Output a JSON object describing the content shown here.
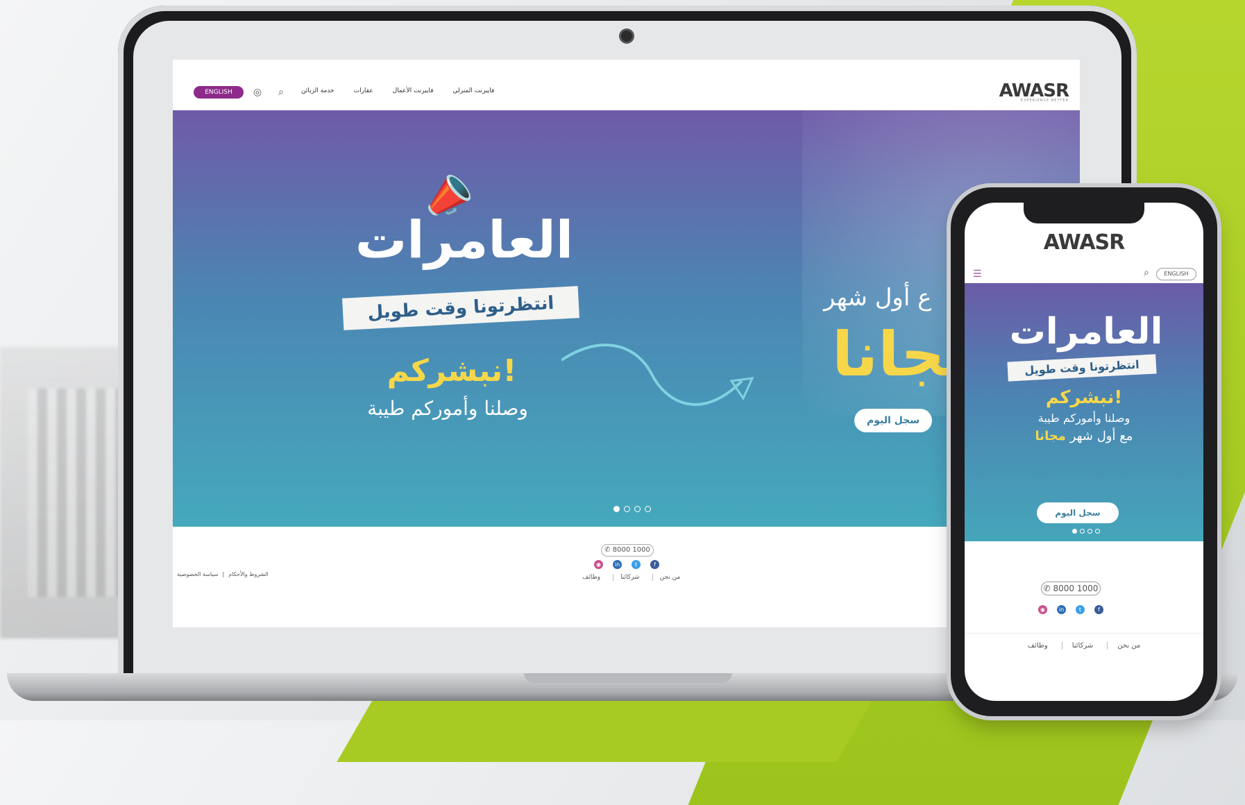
{
  "desktop": {
    "nav": {
      "lang_button": "ENGLISH",
      "links": [
        "خدمة الزبائن",
        "عقارات",
        "فايبرنت الأعمال",
        "فايبرنت المنزلي"
      ],
      "logo": "AWASR",
      "logo_tagline": "EXPERIENCE BETTER"
    },
    "hero": {
      "headline": "العامرات",
      "ribbon": "انتظرتونا وقت طويل",
      "subline1": "نبشركم!",
      "subline2": "وصلنا وأموركم طيبة",
      "right_text1": "ع أول شهر",
      "right_text2": "مجانا",
      "cta": "سجل اليوم",
      "active_slide": 1,
      "slide_count": 4
    },
    "footer": {
      "phone": "8000 1000",
      "links": [
        "من نحن",
        "شركائنا",
        "وظائف"
      ],
      "legal": [
        "الشروط والأحكام",
        "سياسة الخصوصية"
      ]
    }
  },
  "mobile": {
    "logo": "AWASR",
    "lang_button": "ENGLISH",
    "hero": {
      "headline": "العامرات",
      "ribbon": "انتظرتونا وقت طويل",
      "subline1": "نبشركم!",
      "subline2": "وصلنا وأموركم طيبة",
      "subline3_prefix": "مع أول شهر",
      "subline3_accent": "مجانا",
      "cta": "سجل اليوم"
    },
    "footer": {
      "phone": "8000 1000",
      "links": [
        "من نحن",
        "شركائنا",
        "وظائف"
      ]
    }
  },
  "colors": {
    "brand_purple": "#8e2a8b",
    "accent_yellow": "#f7d74a",
    "hero_top": "#6f5aa8",
    "hero_bottom": "#45a9bd",
    "green": "#a8cb23"
  }
}
